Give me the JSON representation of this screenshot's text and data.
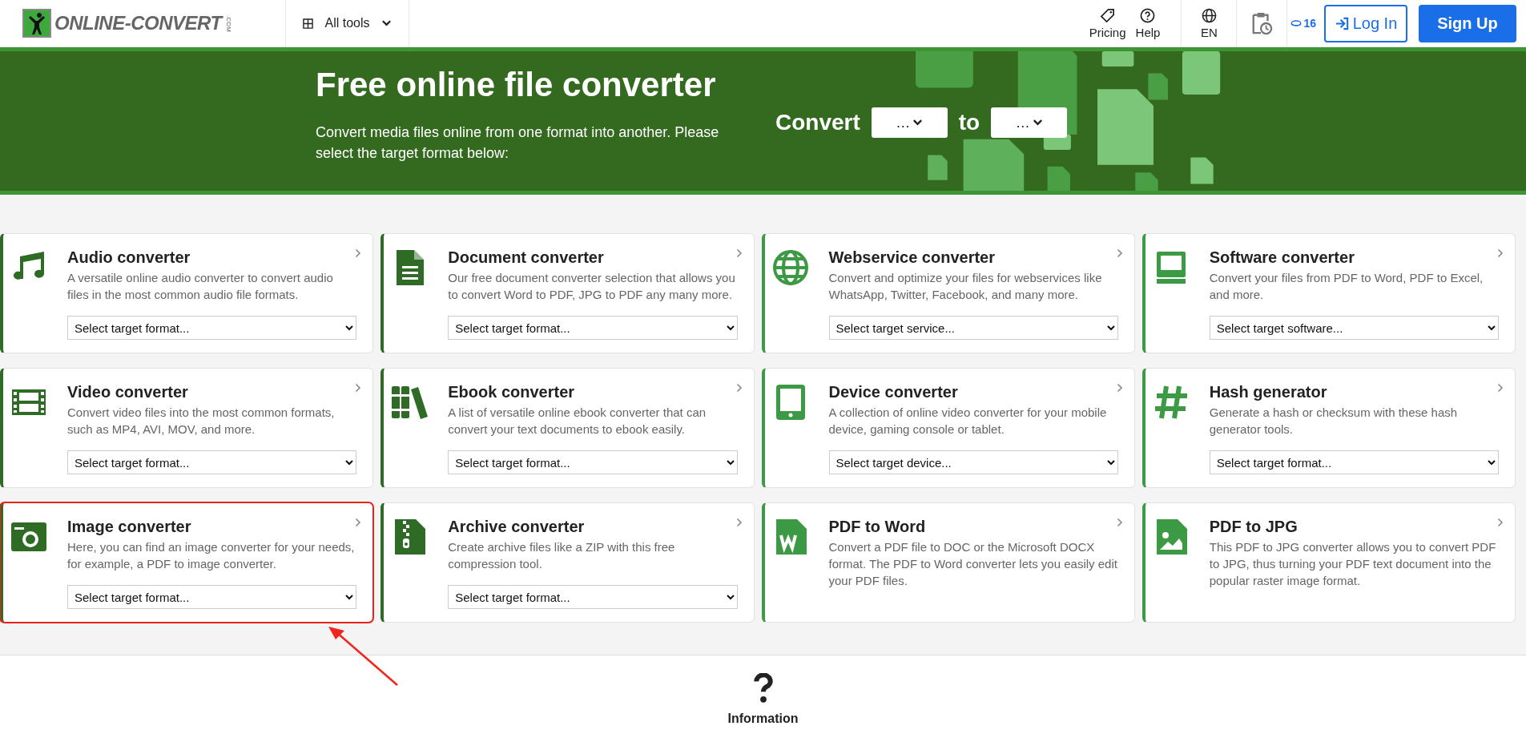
{
  "header": {
    "logo": {
      "name": "ONLINE-CONVERT",
      "suffix": ".COM"
    },
    "all_tools": "All tools",
    "nav": [
      {
        "label": "Pricing"
      },
      {
        "label": "Help"
      }
    ],
    "language": "EN",
    "credits": "16",
    "login": "Log In",
    "signup": "Sign Up"
  },
  "banner": {
    "title": "Free online file converter",
    "subtitle": "Convert media files online from one format into another. Please select the target format below:",
    "convert_label": "Convert",
    "from_value": "…",
    "to_label": "to",
    "to_value": "…"
  },
  "cards": [
    {
      "title": "Audio converter",
      "description": "A versatile online audio converter to convert audio files in the most common audio file formats.",
      "select": "Select target format...",
      "color": "#2e6b25",
      "highlighted": false
    },
    {
      "title": "Document converter",
      "description": "Our free document converter selection that allows you to convert Word to PDF, JPG to PDF any many more.",
      "select": "Select target format...",
      "color": "#2e6b25",
      "highlighted": false
    },
    {
      "title": "Webservice converter",
      "description": "Convert and optimize your files for webservices like WhatsApp, Twitter, Facebook, and many more.",
      "select": "Select target service...",
      "color": "#3c9a44",
      "highlighted": false
    },
    {
      "title": "Software converter",
      "description": "Convert your files from PDF to Word, PDF to Excel, and more.",
      "select": "Select target software...",
      "color": "#3c9a44",
      "highlighted": false
    },
    {
      "title": "Video converter",
      "description": "Convert video files into the most common formats, such as MP4, AVI, MOV, and more.",
      "select": "Select target format...",
      "color": "#2e6b25",
      "highlighted": false
    },
    {
      "title": "Ebook converter",
      "description": "A list of versatile online ebook converter that can convert your text documents to ebook easily.",
      "select": "Select target format...",
      "color": "#2e6b25",
      "highlighted": false
    },
    {
      "title": "Device converter",
      "description": "A collection of online video converter for your mobile device, gaming console or tablet.",
      "select": "Select target device...",
      "color": "#3c9a44",
      "highlighted": false
    },
    {
      "title": "Hash generator",
      "description": "Generate a hash or checksum with these hash generator tools.",
      "select": "Select target format...",
      "color": "#3c9a44",
      "highlighted": false
    },
    {
      "title": "Image converter",
      "description": "Here, you can find an image converter for your needs, for example, a PDF to image converter.",
      "select": "Select target format...",
      "color": "#2e6b25",
      "highlighted": true
    },
    {
      "title": "Archive converter",
      "description": "Create archive files like a ZIP with this free compression tool.",
      "select": "Select target format...",
      "color": "#2e6b25",
      "highlighted": false
    },
    {
      "title": "PDF to Word",
      "description": "Convert a PDF file to DOC or the Microsoft DOCX format. The PDF to Word converter lets you easily edit your PDF files.",
      "color": "#3c9a44",
      "highlighted": false
    },
    {
      "title": "PDF to JPG",
      "description": "This PDF to JPG converter allows you to convert PDF to JPG, thus turning your PDF text document into the popular raster image format.",
      "color": "#3c9a44",
      "highlighted": false
    }
  ],
  "information": {
    "label": "Information"
  }
}
